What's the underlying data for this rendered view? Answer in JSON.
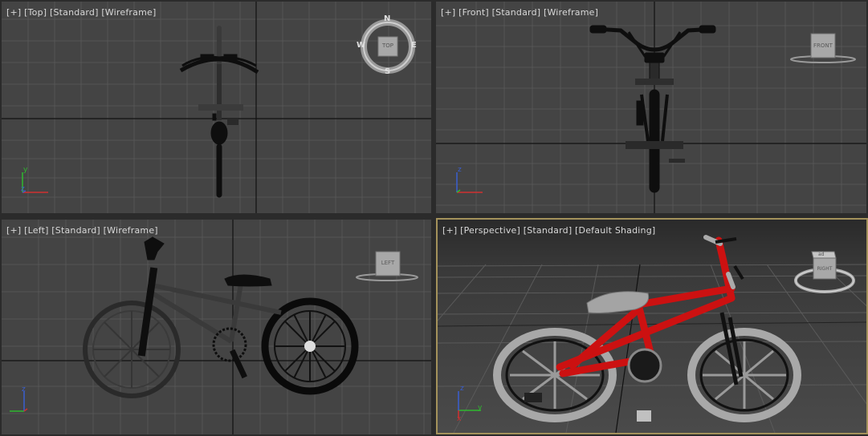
{
  "viewports": {
    "top": {
      "plus": "[+]",
      "view": "[Top]",
      "mode": "[Standard]",
      "shading": "[Wireframe]"
    },
    "front": {
      "plus": "[+]",
      "view": "[Front]",
      "mode": "[Standard]",
      "shading": "[Wireframe]"
    },
    "left": {
      "plus": "[+]",
      "view": "[Left]",
      "mode": "[Standard]",
      "shading": "[Wireframe]"
    },
    "persp": {
      "plus": "[+]",
      "view": "[Perspective]",
      "mode": "[Standard]",
      "shading": "[Default Shading]"
    }
  },
  "viewcube": {
    "top": {
      "face": "TOP",
      "n": "N",
      "s": "S",
      "e": "E",
      "w": "W"
    },
    "front": {
      "face": "FRONT"
    },
    "left": {
      "face": "LEFT"
    },
    "persp": {
      "face_top": "ad",
      "face_side": "RIGHT"
    }
  },
  "axes": {
    "x": "x",
    "y": "y",
    "z": "z"
  },
  "colors": {
    "grid_line": "#555555",
    "home_grid_axis": "#111111",
    "active_border": "#a4925b",
    "bike_frame": "#cc1111",
    "axis_x": "#d03030",
    "axis_y": "#2fb82f",
    "axis_z": "#3a5fd0"
  }
}
